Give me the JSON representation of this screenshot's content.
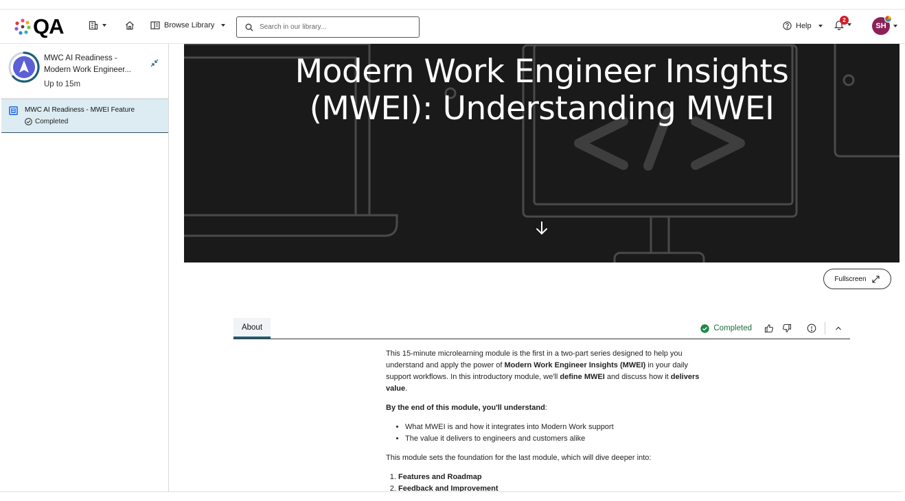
{
  "brand": {
    "logo_text": "QA"
  },
  "topbar": {
    "browse_label": "Browse Library",
    "search_placeholder": "Search in our library...",
    "help_label": "Help",
    "notification_count": "2",
    "avatar_initials": "SH"
  },
  "sidebar": {
    "course_title": "MWC AI Readiness - Modern Work Engineer...",
    "course_duration": "Up to 15m",
    "lesson": {
      "title": "MWC AI Readiness - MWEI Feature",
      "status": "Completed"
    }
  },
  "hero": {
    "title_line1": "Modern Work Engineer Insights",
    "title_line2": "(MWEI): Understanding MWEI"
  },
  "fullscreen_label": "Fullscreen",
  "about": {
    "tab_label": "About",
    "status": "Completed",
    "intro_part1": "This 15-minute microlearning module is the first in a two-part series designed to help you understand and apply the power of ",
    "intro_bold1": "Modern Work Engineer Insights (MWEI)",
    "intro_part2": " in your daily support workflows. In this introductory module, we'll ",
    "intro_bold2": "define MWEI",
    "intro_part3": " and discuss how it ",
    "intro_bold3": "delivers value",
    "intro_part4": ".",
    "outcomes_heading": "By the end of this module, you'll understand",
    "outcomes_colon": ":",
    "outcomes": [
      "What MWEI is and how it integrates into Modern Work support",
      "The value it delivers to engineers and customers alike"
    ],
    "next_text": "This module sets the foundation for the last module, which will dive deeper into:",
    "next_items": [
      "Features and Roadmap",
      "Feedback and Improvement"
    ]
  },
  "colors": {
    "accent": "#1c5f7a",
    "selected_row": "#dcecf2",
    "success": "#1b8a45",
    "badge": "#d31c27",
    "hero_bg": "#1a1a1a"
  }
}
